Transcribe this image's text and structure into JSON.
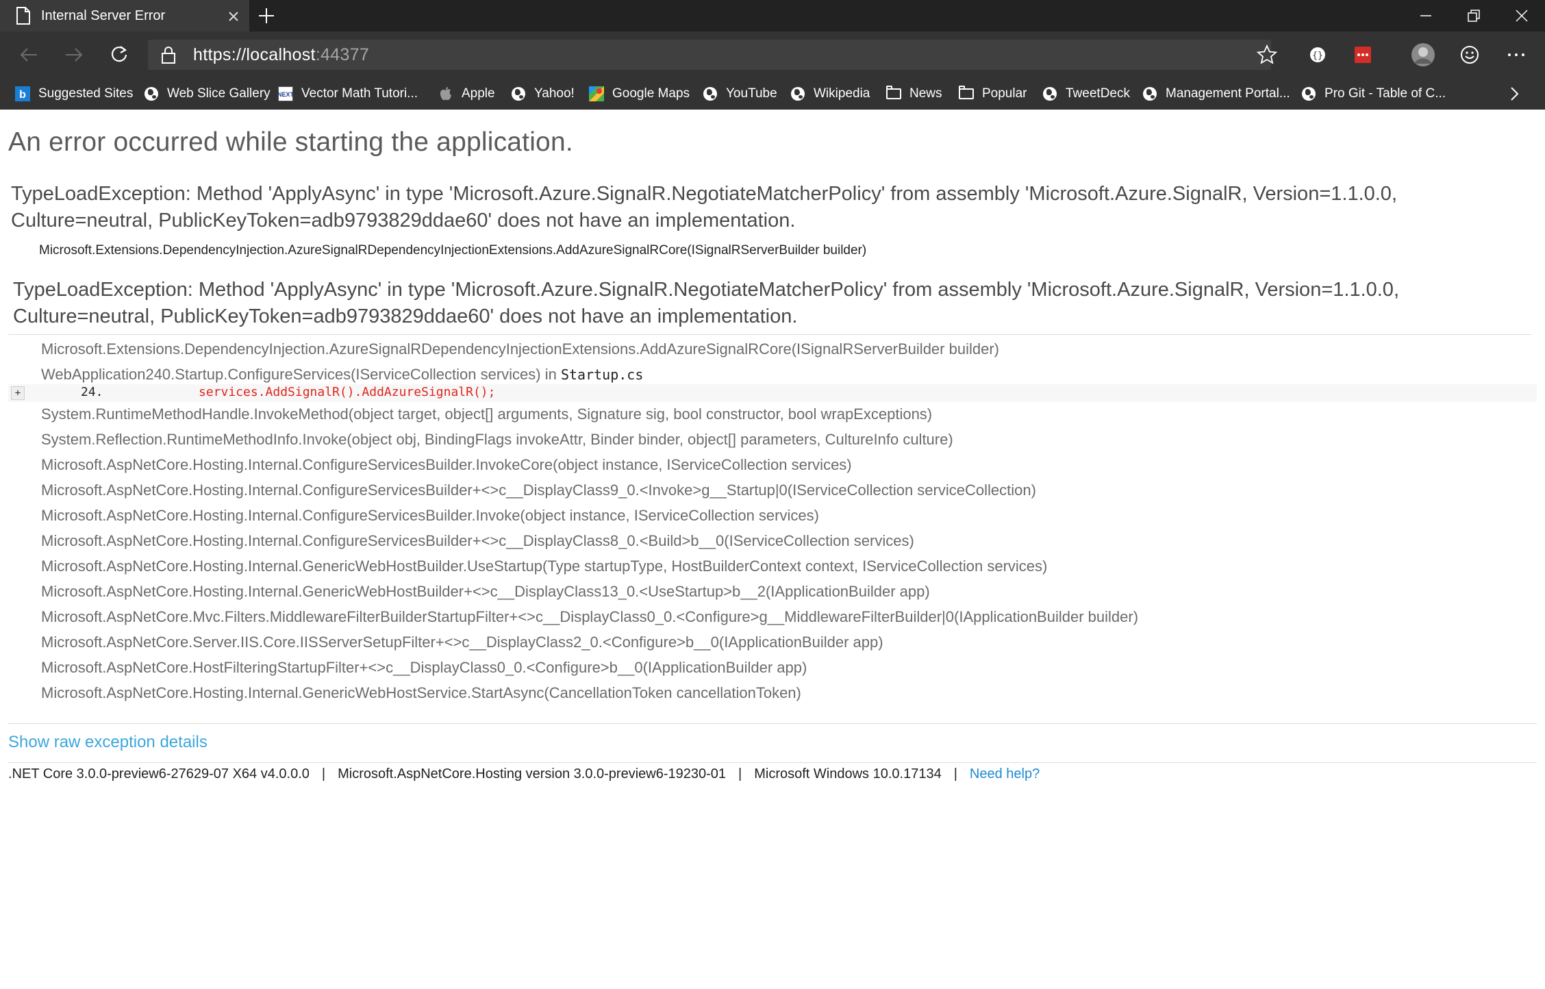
{
  "browser": {
    "tab_title": "Internal Server Error",
    "new_tab_symbol": "+",
    "url_main": "https://localhost",
    "url_port": ":44377",
    "colors": {
      "chrome_dark": "#222222",
      "chrome_bar": "#333333",
      "tab_active": "#3a3a3a"
    }
  },
  "favorites": [
    {
      "label": "Suggested Sites",
      "icon": "bing-icon"
    },
    {
      "label": "Web Slice Gallery",
      "icon": "globe-icon"
    },
    {
      "label": "Vector Math Tutori...",
      "icon": "next-icon"
    },
    {
      "label": "Apple",
      "icon": "apple-icon"
    },
    {
      "label": "Yahoo!",
      "icon": "globe-icon"
    },
    {
      "label": "Google Maps",
      "icon": "maps-icon"
    },
    {
      "label": "YouTube",
      "icon": "globe-icon"
    },
    {
      "label": "Wikipedia",
      "icon": "globe-icon"
    },
    {
      "label": "News",
      "icon": "folder-icon"
    },
    {
      "label": "Popular",
      "icon": "folder-icon"
    },
    {
      "label": "TweetDeck",
      "icon": "globe-icon"
    },
    {
      "label": "Management Portal...",
      "icon": "globe-icon"
    },
    {
      "label": "Pro Git - Table of C...",
      "icon": "globe-icon"
    }
  ],
  "page": {
    "heading": "An error occurred while starting the application.",
    "exception1": {
      "title": "TypeLoadException: Method 'ApplyAsync' in type 'Microsoft.Azure.SignalR.NegotiateMatcherPolicy' from assembly 'Microsoft.Azure.SignalR, Version=1.1.0.0, Culture=neutral, PublicKeyToken=adb9793829ddae60' does not have an implementation.",
      "location": "Microsoft.Extensions.DependencyInjection.AzureSignalRDependencyInjectionExtensions.AddAzureSignalRCore(ISignalRServerBuilder builder)"
    },
    "exception2": {
      "title": "TypeLoadException: Method 'ApplyAsync' in type 'Microsoft.Azure.SignalR.NegotiateMatcherPolicy' from assembly 'Microsoft.Azure.SignalR, Version=1.1.0.0, Culture=neutral, PublicKeyToken=adb9793829ddae60' does not have an implementation."
    },
    "stack": {
      "frame0": "Microsoft.Extensions.DependencyInjection.AzureSignalRDependencyInjectionExtensions.AddAzureSignalRCore(ISignalRServerBuilder builder)",
      "frame1_method": "WebApplication240.Startup.ConfigureServices(IServiceCollection services) in ",
      "frame1_file": "Startup.cs",
      "code_expand": "+",
      "code_line_no": "24.",
      "code_line": "services.AddSignalR().AddAzureSignalR();",
      "frames": [
        "System.RuntimeMethodHandle.InvokeMethod(object target, object[] arguments, Signature sig, bool constructor, bool wrapExceptions)",
        "System.Reflection.RuntimeMethodInfo.Invoke(object obj, BindingFlags invokeAttr, Binder binder, object[] parameters, CultureInfo culture)",
        "Microsoft.AspNetCore.Hosting.Internal.ConfigureServicesBuilder.InvokeCore(object instance, IServiceCollection services)",
        "Microsoft.AspNetCore.Hosting.Internal.ConfigureServicesBuilder+<>c__DisplayClass9_0.<Invoke>g__Startup|0(IServiceCollection serviceCollection)",
        "Microsoft.AspNetCore.Hosting.Internal.ConfigureServicesBuilder.Invoke(object instance, IServiceCollection services)",
        "Microsoft.AspNetCore.Hosting.Internal.ConfigureServicesBuilder+<>c__DisplayClass8_0.<Build>b__0(IServiceCollection services)",
        "Microsoft.AspNetCore.Hosting.Internal.GenericWebHostBuilder.UseStartup(Type startupType, HostBuilderContext context, IServiceCollection services)",
        "Microsoft.AspNetCore.Hosting.Internal.GenericWebHostBuilder+<>c__DisplayClass13_0.<UseStartup>b__2(IApplicationBuilder app)",
        "Microsoft.AspNetCore.Mvc.Filters.MiddlewareFilterBuilderStartupFilter+<>c__DisplayClass0_0.<Configure>g__MiddlewareFilterBuilder|0(IApplicationBuilder builder)",
        "Microsoft.AspNetCore.Server.IIS.Core.IISServerSetupFilter+<>c__DisplayClass2_0.<Configure>b__0(IApplicationBuilder app)",
        "Microsoft.AspNetCore.HostFilteringStartupFilter+<>c__DisplayClass0_0.<Configure>b__0(IApplicationBuilder app)",
        "Microsoft.AspNetCore.Hosting.Internal.GenericWebHostService.StartAsync(CancellationToken cancellationToken)"
      ]
    },
    "raw_link": "Show raw exception details",
    "footer": {
      "runtime": ".NET Core 3.0.0-preview6-27629-07 X64 v4.0.0.0",
      "hosting": "Microsoft.AspNetCore.Hosting version 3.0.0-preview6-19230-01",
      "os": "Microsoft Windows 10.0.17134",
      "separator": "|",
      "help": "Need help?"
    },
    "colors": {
      "code_red": "#e0241b",
      "link_blue": "#3ca6dd",
      "help_blue": "#1b8ad2"
    }
  }
}
